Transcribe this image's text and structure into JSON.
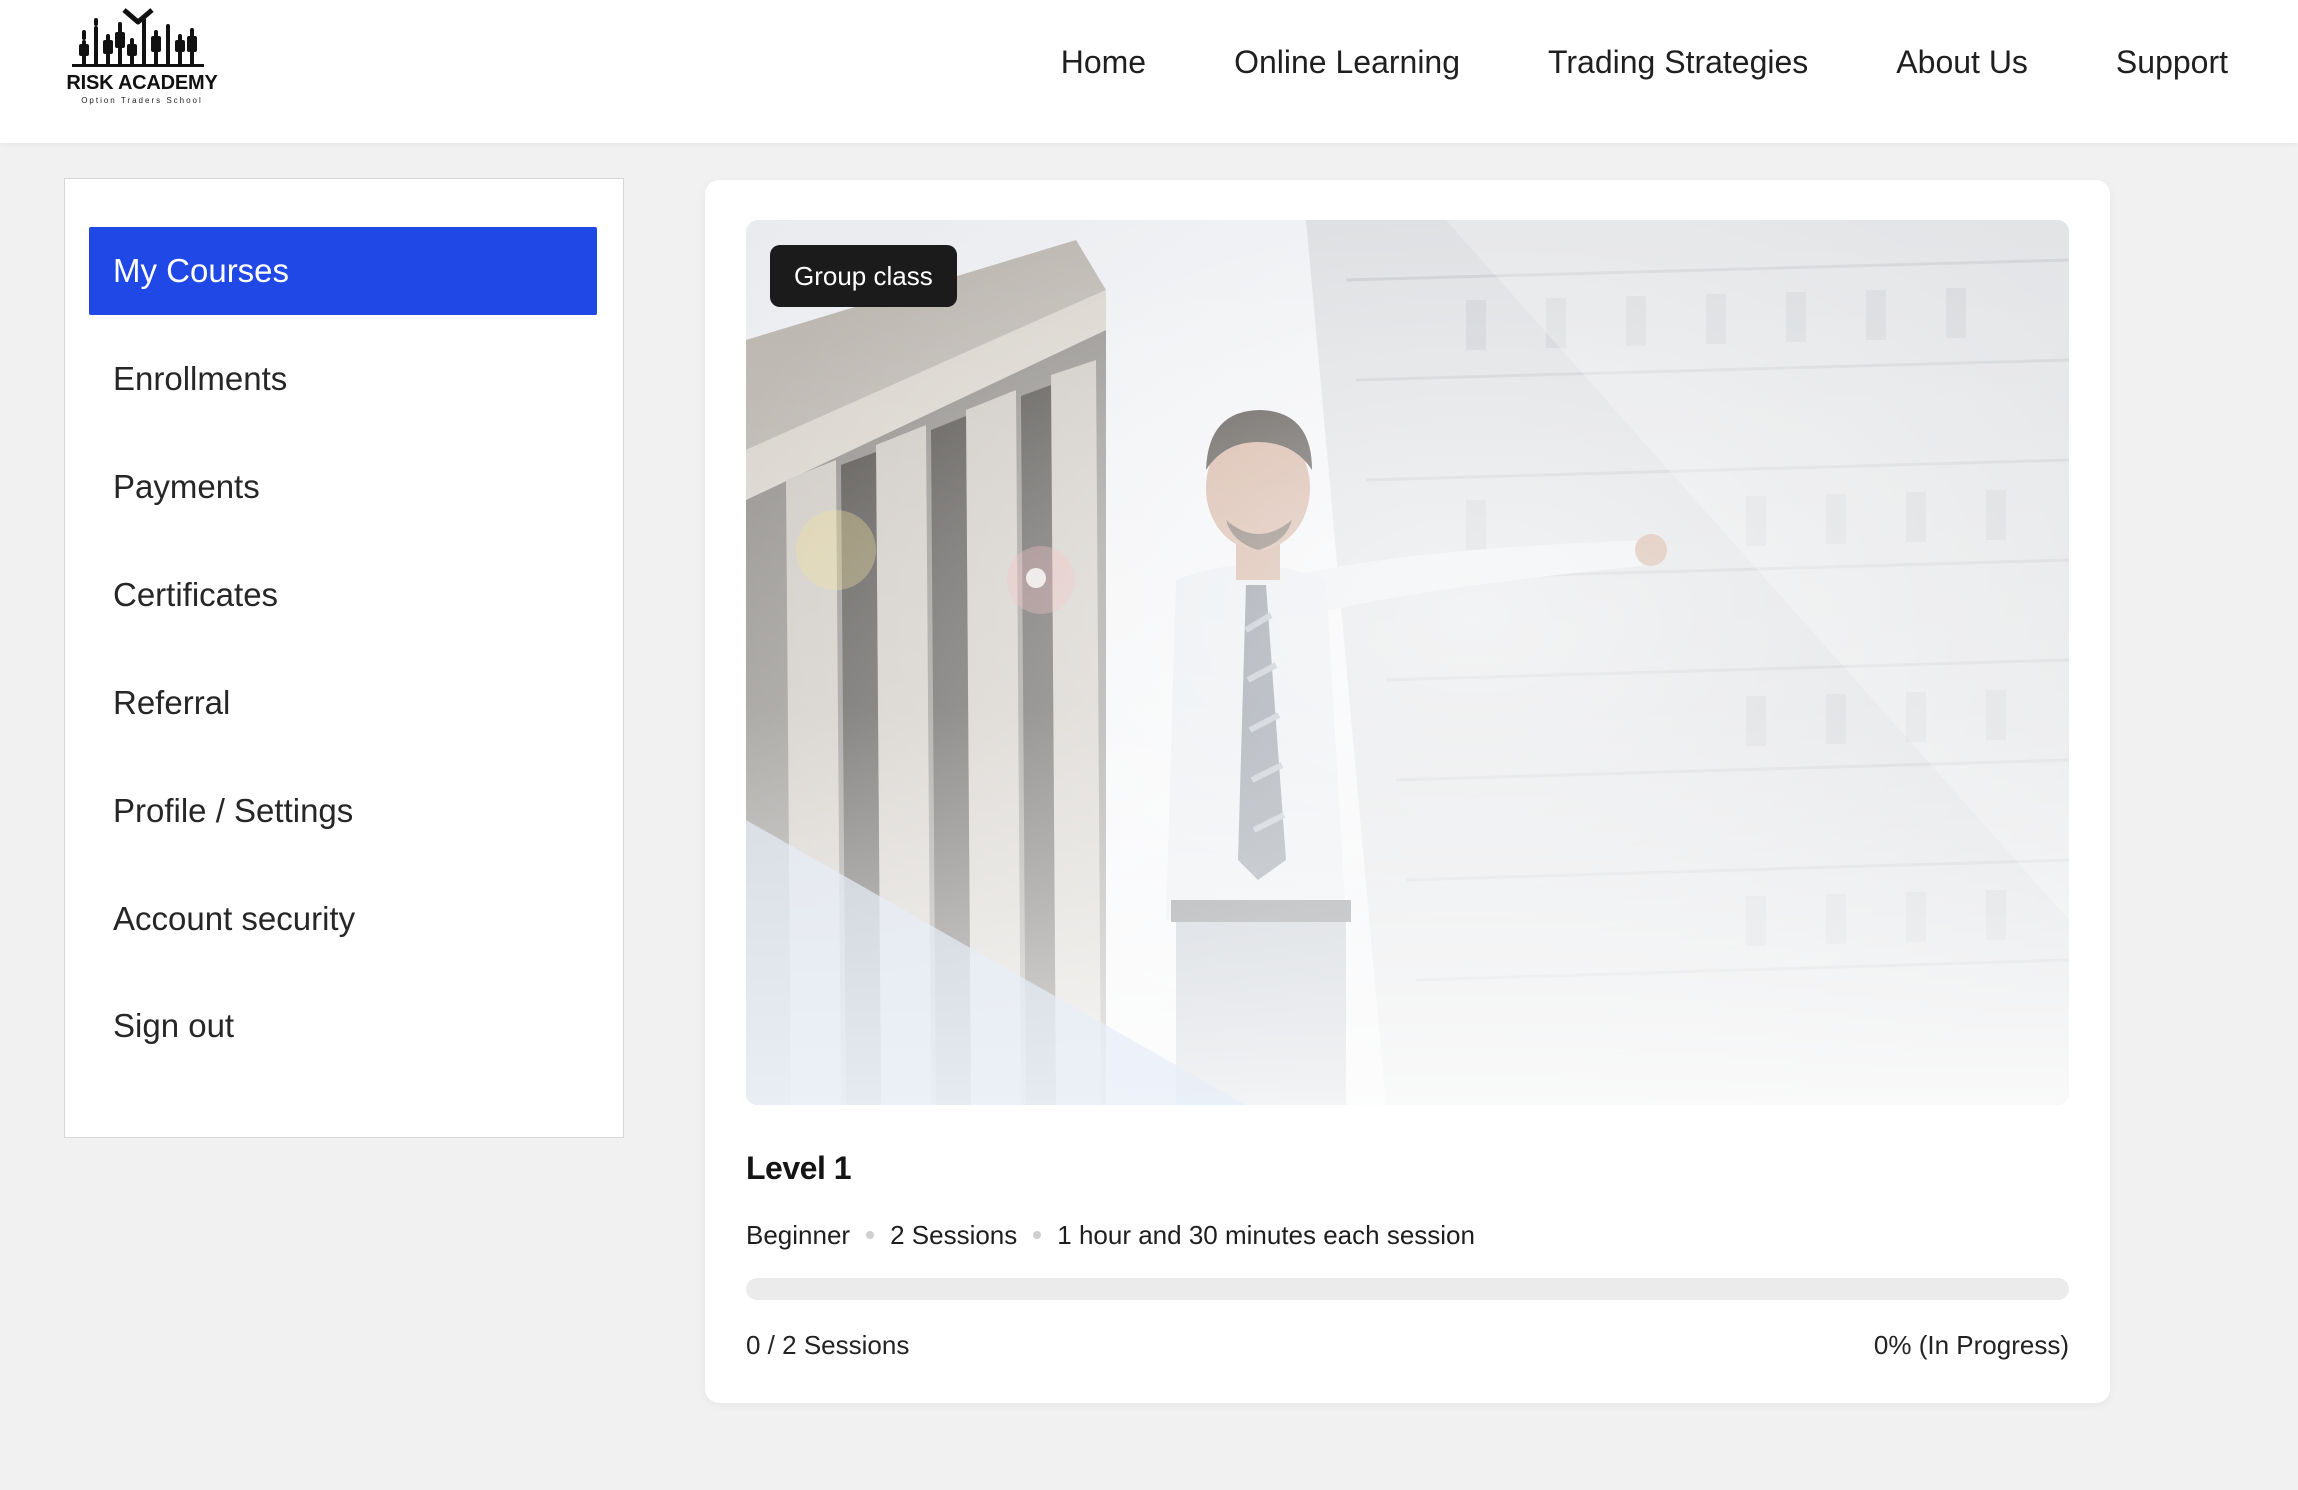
{
  "brand": {
    "name": "RISK ACADEMY",
    "tagline": "Option Traders School"
  },
  "nav": {
    "items": [
      {
        "label": "Home"
      },
      {
        "label": "Online Learning"
      },
      {
        "label": "Trading Strategies"
      },
      {
        "label": "About Us"
      },
      {
        "label": "Support"
      }
    ]
  },
  "sidebar": {
    "active_index": 0,
    "items": [
      {
        "label": "My Courses"
      },
      {
        "label": "Enrollments"
      },
      {
        "label": "Payments"
      },
      {
        "label": "Certificates"
      },
      {
        "label": "Referral"
      },
      {
        "label": "Profile / Settings"
      },
      {
        "label": "Account security"
      },
      {
        "label": "Sign out"
      }
    ]
  },
  "course": {
    "badge": "Group class",
    "title": "Level 1",
    "meta": {
      "level": "Beginner",
      "sessions": "2 Sessions",
      "duration": "1 hour and 30 minutes each session"
    },
    "progress_fraction": 0,
    "sessions_count": "0 / 2 Sessions",
    "status": "0% (In Progress)"
  },
  "colors": {
    "accent": "#1f48e6",
    "badge_bg": "#1b1b1b",
    "page_bg": "#f1f1f1"
  },
  "icons": {
    "logo": "risk-academy-logo-icon",
    "meta_separator": "dot-separator-icon"
  }
}
